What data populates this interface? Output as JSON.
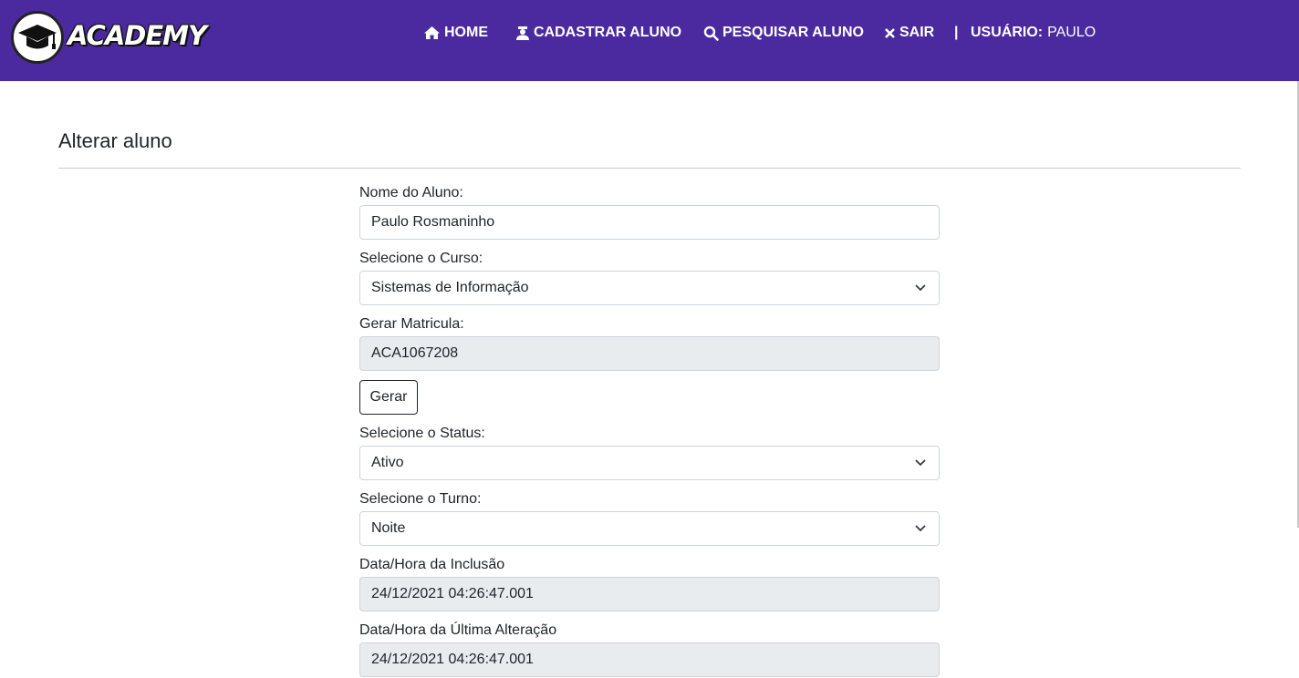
{
  "brand": {
    "name": "ACADEMY",
    "logo_icon": "graduation-cap-icon"
  },
  "nav": {
    "home": {
      "label": "HOME",
      "icon": "home-icon"
    },
    "cadastrar": {
      "label": "CADASTRAR ALUNO",
      "icon": "student-icon"
    },
    "pesquisar": {
      "label": "PESQUISAR ALUNO",
      "icon": "search-icon"
    },
    "sair": {
      "label": "SAIR",
      "icon": "close-icon"
    },
    "separator": "|",
    "user_label": "USUÁRIO:",
    "user_value": "PAULO"
  },
  "page": {
    "title": "Alterar aluno"
  },
  "form": {
    "nome": {
      "label": "Nome do Aluno:",
      "value": "Paulo Rosmaninho"
    },
    "curso": {
      "label": "Selecione o Curso:",
      "value": "Sistemas de Informação"
    },
    "matricula": {
      "label": "Gerar Matricula:",
      "value": "ACA1067208"
    },
    "gerar_button": "Gerar",
    "status": {
      "label": "Selecione o Status:",
      "value": "Ativo"
    },
    "turno": {
      "label": "Selecione o Turno:",
      "value": "Noite"
    },
    "inclusao": {
      "label": "Data/Hora da Inclusão",
      "value": "24/12/2021 04:26:47.001"
    },
    "alteracao": {
      "label": "Data/Hora da Última Alteração",
      "value": "24/12/2021 04:26:47.001"
    }
  },
  "colors": {
    "navbar": "#4b2aa0",
    "readonly_bg": "#e9ecef",
    "border": "#ced4da"
  }
}
